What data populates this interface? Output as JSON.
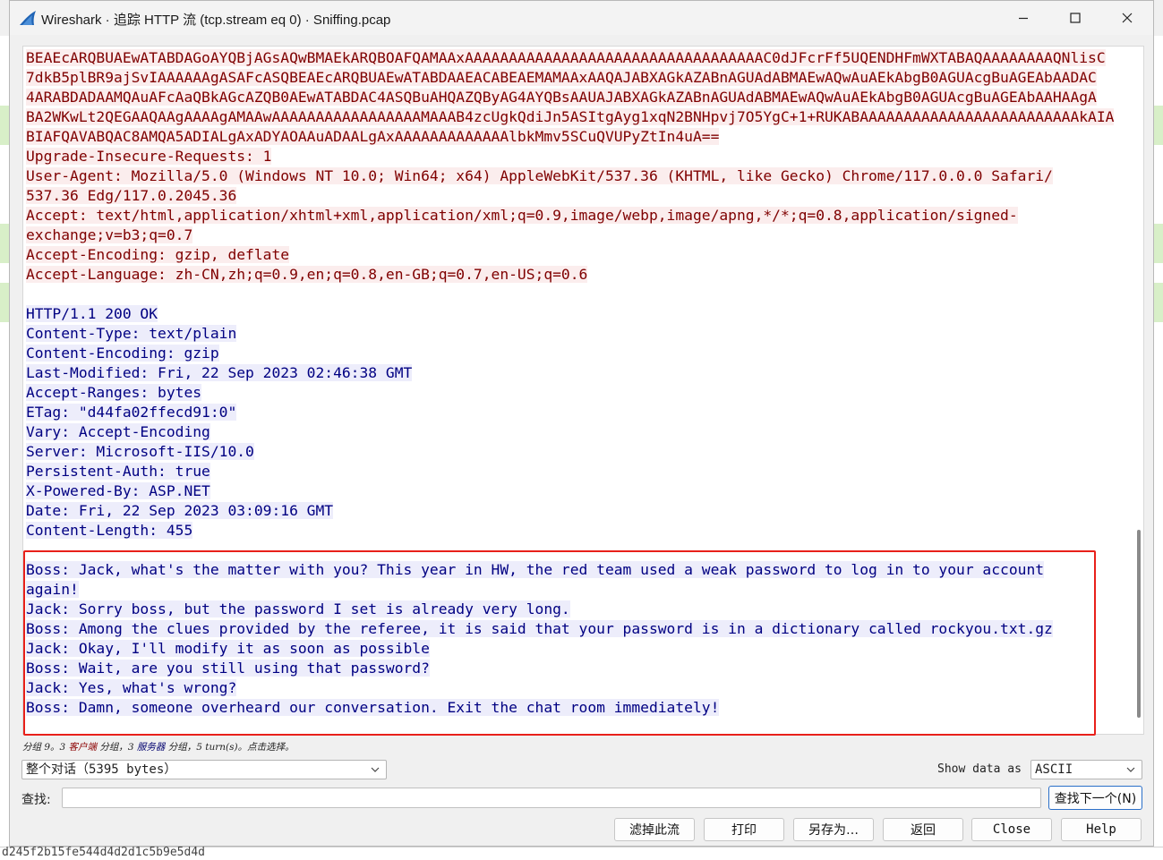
{
  "window": {
    "title": "Wireshark · 追踪 HTTP 流 (tcp.stream eq 0) · Sniffing.pcap"
  },
  "stream": {
    "client_lines": [
      "BEAEcARQBUAEwATABDAGoAYQBjAGsAQwBMAEkARQBOAFQAMAAxAAAAAAAAAAAAAAAAAAAAAAAAAAAAAAAAAAC0dJFcrFf5UQENDHFmWXTABAQAAAAAAAAQNlisC",
      "7dkB5plBR9ajSvIAAAAAAgASAFcASQBEAEcARQBUAEwATABDAAEACABEAEMAMAAxAAQAJABXAGkAZABnAGUAdABMAEwAQwAuAEkAbgB0AGUAcgBuAGEAbAADAC",
      "4ARABDADAAMQAuAFcAaQBkAGcAZQB0AEwATABDAC4ASQBuAHQAZQByAG4AYQBsAAUAJABXAGkAZABnAGUAdABMAEwAQwAuAEkAbgB0AGUAcgBuAGEAbAAHAAgA",
      "BA2WKwLt2QEGAAQAAgAAAAgAMAAwAAAAAAAAAAAAAAAAAMAAAB4zcUgkQdiJn5ASItgAyg1xqN2BNHpvj7O5YgC+1+RUKABAAAAAAAAAAAAAAAAAAAAAAAAAkAIA",
      "BIAFQAVABQAC8AMQA5ADIALgAxADYAOAAuADAALgAxAAAAAAAAAAAAAlbkMmv5SCuQVUPyZtIn4uA==",
      "Upgrade-Insecure-Requests: 1",
      "User-Agent: Mozilla/5.0 (Windows NT 10.0; Win64; x64) AppleWebKit/537.36 (KHTML, like Gecko) Chrome/117.0.0.0 Safari/",
      "537.36 Edg/117.0.2045.36",
      "Accept: text/html,application/xhtml+xml,application/xml;q=0.9,image/webp,image/apng,*/*;q=0.8,application/signed-",
      "exchange;v=b3;q=0.7",
      "Accept-Encoding: gzip, deflate",
      "Accept-Language: zh-CN,zh;q=0.9,en;q=0.8,en-GB;q=0.7,en-US;q=0.6"
    ],
    "server_lines": [
      "HTTP/1.1 200 OK",
      "Content-Type: text/plain",
      "Content-Encoding: gzip",
      "Last-Modified: Fri, 22 Sep 2023 02:46:38 GMT",
      "Accept-Ranges: bytes",
      "ETag: \"d44fa02ffecd91:0\"",
      "Vary: Accept-Encoding",
      "Server: Microsoft-IIS/10.0",
      "Persistent-Auth: true",
      "X-Powered-By: ASP.NET",
      "Date: Fri, 22 Sep 2023 03:09:16 GMT",
      "Content-Length: 455"
    ],
    "body_lines": [
      "Boss: Jack, what's the matter with you? This year in HW, the red team used a weak password to log in to your account",
      "again!",
      "Jack: Sorry boss, but the password I set is already very long.",
      "Boss: Among the clues provided by the referee, it is said that your password is in a dictionary called rockyou.txt.gz",
      "Jack: Okay, I'll modify it as soon as possible",
      "Boss: Wait, are you still using that password?",
      "Jack: Yes, what's wrong?",
      "Boss: Damn, someone overheard our conversation. Exit the chat room immediately!"
    ]
  },
  "status": {
    "prefix": "分组 9。3 ",
    "client": "客户端",
    "middle": " 分组，3 ",
    "server": "服务器",
    "suffix": " 分组，5 turn(s)。点击选择。"
  },
  "controls": {
    "conversation_select": "整个对话（5395 bytes）",
    "show_data_as_label": "Show data as",
    "show_data_as_value": "ASCII",
    "find_label": "查找:",
    "find_value": "",
    "find_next": "查找下一个(N)",
    "filter_out": "滤掉此流",
    "print": "打印",
    "save_as": "另存为…",
    "back": "返回",
    "close": "Close",
    "help": "Help"
  },
  "background": {
    "bottom_text": "d245f2b15fe544d4d2d1c5b9e5d4d"
  },
  "colors": {
    "client_text": "#7f0000",
    "client_bg": "#fbeded",
    "server_text": "#000082",
    "server_bg": "#ededfb",
    "highlight": "#e8201a",
    "accent": "#2a6fc9"
  }
}
